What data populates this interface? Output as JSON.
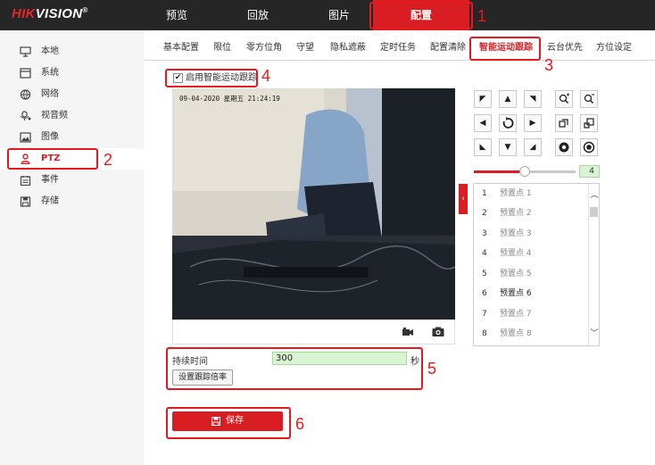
{
  "app": {
    "logo_brand": "HIK",
    "logo_rest": "VISION",
    "logo_mark": "®"
  },
  "topnav": {
    "items": [
      {
        "label": "预览",
        "active": false
      },
      {
        "label": "回放",
        "active": false
      },
      {
        "label": "图片",
        "active": false
      },
      {
        "label": "配置",
        "active": true
      }
    ]
  },
  "sidebar": {
    "items": [
      {
        "label": "本地",
        "icon": "monitor-icon",
        "active": false
      },
      {
        "label": "系统",
        "icon": "system-icon",
        "active": false
      },
      {
        "label": "网络",
        "icon": "globe-icon",
        "active": false
      },
      {
        "label": "视音频",
        "icon": "audio-video-icon",
        "active": false
      },
      {
        "label": "图像",
        "icon": "image-icon",
        "active": false
      },
      {
        "label": "PTZ",
        "icon": "ptz-person-icon",
        "active": true
      },
      {
        "label": "事件",
        "icon": "event-icon",
        "active": false
      },
      {
        "label": "存储",
        "icon": "storage-icon",
        "active": false
      }
    ]
  },
  "tabs": [
    {
      "label": "基本配置",
      "active": false
    },
    {
      "label": "限位",
      "active": false
    },
    {
      "label": "零方位角",
      "active": false
    },
    {
      "label": "守望",
      "active": false
    },
    {
      "label": "隐私遮蔽",
      "active": false
    },
    {
      "label": "定时任务",
      "active": false
    },
    {
      "label": "配置清除",
      "active": false
    },
    {
      "label": "智能运动跟踪",
      "active": true
    },
    {
      "label": "云台优先",
      "active": false
    },
    {
      "label": "方位设定",
      "active": false
    }
  ],
  "tracking": {
    "enable_label": "启用智能运动跟踪",
    "enabled": true,
    "check_mark": "✔"
  },
  "video": {
    "timestamp": "09-04-2020 星期五 21:24:19",
    "controls": [
      "record-icon",
      "camera-icon"
    ]
  },
  "ptz": {
    "speed": 4,
    "speed_fraction": 0.5,
    "buttons": [
      [
        "up-left-arrow-icon",
        "up-arrow-icon",
        "up-right-arrow-icon",
        "zoom-in-icon",
        "zoom-out-icon"
      ],
      [
        "left-arrow-icon",
        "auto-rotate-icon",
        "right-arrow-icon",
        "focus-near-icon",
        "focus-far-icon"
      ],
      [
        "down-left-arrow-icon",
        "down-arrow-icon",
        "down-right-arrow-icon",
        "iris-open-icon",
        "iris-close-icon"
      ]
    ]
  },
  "presets": [
    {
      "num": "1",
      "name": "预置点 1",
      "bold": false
    },
    {
      "num": "2",
      "name": "预置点 2",
      "bold": false
    },
    {
      "num": "3",
      "name": "预置点 3",
      "bold": false
    },
    {
      "num": "4",
      "name": "预置点 4",
      "bold": false
    },
    {
      "num": "5",
      "name": "预置点 5",
      "bold": false
    },
    {
      "num": "6",
      "name": "预置点 6",
      "bold": true
    },
    {
      "num": "7",
      "name": "预置点 7",
      "bold": false
    },
    {
      "num": "8",
      "name": "预置点 8",
      "bold": false
    }
  ],
  "form": {
    "duration_label": "持续时间",
    "duration_value": "300",
    "duration_unit": "秒",
    "ratio_button": "设置跟踪倍率"
  },
  "save": {
    "label": "保存"
  },
  "annotations": {
    "color": "#e8191d",
    "labels": [
      "1",
      "2",
      "3",
      "4",
      "5",
      "6"
    ]
  },
  "colors": {
    "accent": "#d81e22",
    "topbar": "#262626",
    "input_green": "#d9f4d2"
  }
}
